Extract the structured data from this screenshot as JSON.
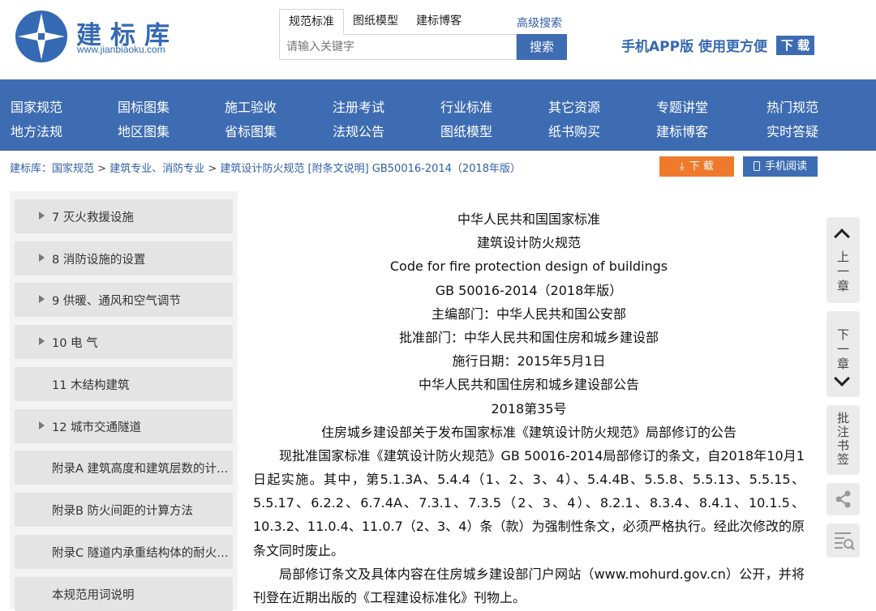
{
  "logo": {
    "name": "建标库",
    "url": "www.jianbiaoku.com"
  },
  "search": {
    "tabs": [
      "规范标准",
      "图纸模型",
      "建标博客"
    ],
    "advanced": "高级搜索",
    "placeholder": "请输入关键字",
    "button": "搜索"
  },
  "app_promo": {
    "text": "手机APP版  使用更方便",
    "download": "下 载"
  },
  "nav": {
    "row1": [
      "国家规范",
      "国标图集",
      "施工验收",
      "注册考试",
      "行业标准",
      "其它资源",
      "专题讲堂",
      "热门规范"
    ],
    "row2": [
      "地方法规",
      "地区图集",
      "省标图集",
      "法规公告",
      "图纸模型",
      "纸书购买",
      "建标博客",
      "实时答疑"
    ]
  },
  "breadcrumb": {
    "home": "建标库：",
    "items": [
      "国家规范",
      "建筑专业、消防专业",
      "建筑设计防火规范 [附条文说明] GB50016-2014（2018年版）"
    ],
    "separator": " > "
  },
  "actions": {
    "download": "下 载",
    "mobile_read": "手机阅读"
  },
  "sidebar": {
    "items": [
      {
        "label": "7 灭火救援设施",
        "expandable": true
      },
      {
        "label": "8 消防设施的设置",
        "expandable": true
      },
      {
        "label": "9 供暖、通风和空气调节",
        "expandable": true
      },
      {
        "label": "10 电 气",
        "expandable": true
      },
      {
        "label": "11 木结构建筑",
        "expandable": false
      },
      {
        "label": "12 城市交通隧道",
        "expandable": true
      },
      {
        "label": "附录A 建筑高度和建筑层数的计算方法",
        "expandable": false
      },
      {
        "label": "附录B 防火间距的计算方法",
        "expandable": false
      },
      {
        "label": "附录C 隧道内承重结构体的耐火极限试验升温曲线和相应的判定标准",
        "expandable": false
      },
      {
        "label": "本规范用词说明",
        "expandable": false
      }
    ]
  },
  "document": {
    "lines": [
      "中华人民共和国国家标准",
      "建筑设计防火规范",
      "Code for fire protection design of buildings",
      "GB 50016-2014（2018年版）",
      "主编部门：中华人民共和国公安部",
      "批准部门：中华人民共和国住房和城乡建设部",
      "施行日期：2015年5月1日",
      "中华人民共和国住房和城乡建设部公告",
      "2018第35号",
      "住房城乡建设部关于发布国家标准《建筑设计防火规范》局部修订的公告"
    ],
    "paragraphs": [
      "现批准国家标准《建筑设计防火规范》GB 50016-2014局部修订的条文，自2018年10月1日起实施。其中，第5.1.3A、5.4.4（1、2、3、4）、5.4.4B、5.5.8、5.5.13、5.5.15、5.5.17、6.2.2、6.7.4A、7.3.1、7.3.5（2、3、4）、8.2.1、8.3.4、8.4.1、10.1.5、10.3.2、11.0.4、11.0.7（2、3、4）条（款）为强制性条文，必须严格执行。经此次修改的原条文同时废止。",
      "局部修订条文及具体内容在住房城乡建设部门户网站（www.mohurd.gov.cn）公开，并将刊登在近期出版的《工程建设标准化》刊物上。"
    ]
  },
  "tools": {
    "prev": "上一章",
    "next": "下一章",
    "bookmark": "批注书签",
    "share_icon": "share-icon",
    "search_icon": "find-in-page-icon"
  },
  "colors": {
    "brand": "#3e6cb2",
    "download": "#f07a2b"
  }
}
